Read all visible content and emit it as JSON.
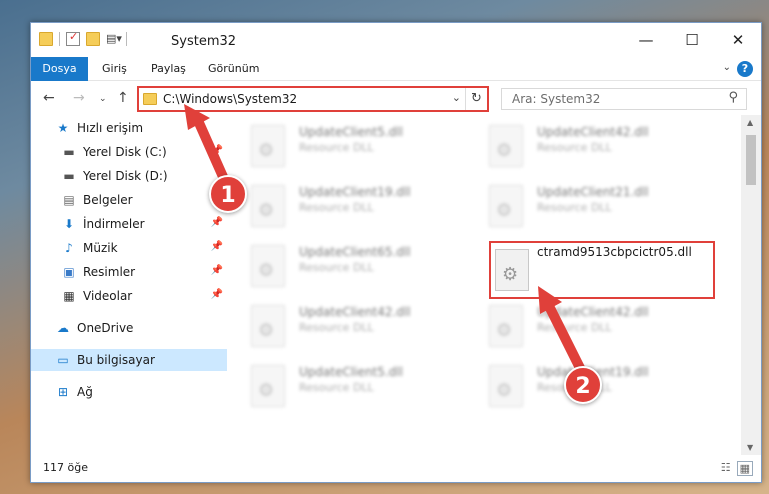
{
  "window": {
    "title": "System32",
    "caption": {
      "minimize": "—",
      "maximize": "☐",
      "close": "✕"
    }
  },
  "ribbon": {
    "tabs": [
      {
        "label": "Dosya"
      },
      {
        "label": "Giriş"
      },
      {
        "label": "Paylaş"
      },
      {
        "label": "Görünüm"
      }
    ],
    "help": "?"
  },
  "navigation": {
    "address_path": "C:\\Windows\\System32",
    "search_placeholder": "Ara: System32"
  },
  "sidebar": {
    "items": [
      {
        "label": "Hızlı erişim",
        "icon": "star-icon",
        "glyph": "★"
      },
      {
        "label": "Yerel Disk (C:)",
        "icon": "drive-icon",
        "glyph": "▬",
        "pinned": true
      },
      {
        "label": "Yerel Disk (D:)",
        "icon": "drive-icon",
        "glyph": "▬",
        "pinned": false
      },
      {
        "label": "Belgeler",
        "icon": "documents-icon",
        "glyph": "▤",
        "pinned": true
      },
      {
        "label": "İndirmeler",
        "icon": "download-icon",
        "glyph": "⬇",
        "pinned": true
      },
      {
        "label": "Müzik",
        "icon": "music-icon",
        "glyph": "♪",
        "pinned": true
      },
      {
        "label": "Resimler",
        "icon": "pictures-icon",
        "glyph": "▣",
        "pinned": true
      },
      {
        "label": "Videolar",
        "icon": "video-icon",
        "glyph": "▦",
        "pinned": true
      },
      {
        "label": "OneDrive",
        "icon": "cloud-icon",
        "glyph": "☁"
      },
      {
        "label": "Bu bilgisayar",
        "icon": "computer-icon",
        "glyph": "▭",
        "selected": true
      },
      {
        "label": "Ağ",
        "icon": "network-icon",
        "glyph": "⊞"
      }
    ]
  },
  "files": [
    {
      "name": "UpdateClient5.dll",
      "type": "Resource DLL"
    },
    {
      "name": "UpdateClient42.dll",
      "type": "Resource DLL"
    },
    {
      "name": "UpdateClient19.dll",
      "type": "Resource DLL"
    },
    {
      "name": "UpdateClient21.dll",
      "type": "Resource DLL"
    },
    {
      "name": "UpdateClient65.dll",
      "type": "Resource DLL"
    },
    {
      "name": "ctramd9513cbpcictr05.dll",
      "type": ""
    },
    {
      "name": "UpdateClient42.dll",
      "type": "Resource DLL"
    },
    {
      "name": "UpdateClient42.dll",
      "type": "Resource DLL"
    },
    {
      "name": "UpdateClient5.dll",
      "type": "Resource DLL"
    },
    {
      "name": "UpdateClient19.dll",
      "type": "Resource DLL"
    }
  ],
  "status": {
    "item_count": "117 öğe"
  },
  "callouts": {
    "one": "1",
    "two": "2"
  },
  "colors": {
    "accent": "#1979ca",
    "highlight": "#e0403a",
    "selected_bg": "#cce8ff"
  }
}
